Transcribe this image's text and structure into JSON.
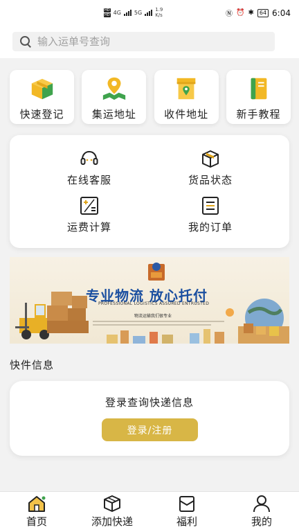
{
  "status_bar": {
    "hd1": "HD",
    "hd2": "HD",
    "net1": "4G",
    "net2": "5G",
    "speed_value": "1.9",
    "speed_unit": "K/s",
    "battery": "64",
    "time": "6:04"
  },
  "search": {
    "placeholder": "输入运单号查询"
  },
  "quick_actions": [
    {
      "label": "快速登记",
      "icon": "box-icon"
    },
    {
      "label": "集运地址",
      "icon": "map-pin-icon"
    },
    {
      "label": "收件地址",
      "icon": "store-location-icon"
    },
    {
      "label": "新手教程",
      "icon": "book-icon"
    }
  ],
  "services": [
    {
      "label": "在线客服",
      "icon": "headset-icon"
    },
    {
      "label": "货品状态",
      "icon": "package-icon"
    },
    {
      "label": "运费计算",
      "icon": "calculator-icon"
    },
    {
      "label": "我的订单",
      "icon": "order-list-icon"
    }
  ],
  "banner": {
    "title": "专业物流 放心托付",
    "subtitle": "PROFESSIONAL LOGISTICS ASSURED ENTRUSTED",
    "caption": "物流运输我们很专业"
  },
  "section": {
    "title": "快件信息"
  },
  "info_card": {
    "text": "登录查询快递信息",
    "button": "登录/注册"
  },
  "bottom_nav": [
    {
      "label": "首页",
      "icon": "home-icon",
      "active": true
    },
    {
      "label": "添加快递",
      "icon": "add-package-icon"
    },
    {
      "label": "福利",
      "icon": "gift-icon"
    },
    {
      "label": "我的",
      "icon": "user-icon"
    }
  ],
  "colors": {
    "accent": "#d8b646",
    "icon_gold": "#f2b825",
    "icon_green": "#3fa34d",
    "banner_blue": "#1b4fa0"
  }
}
